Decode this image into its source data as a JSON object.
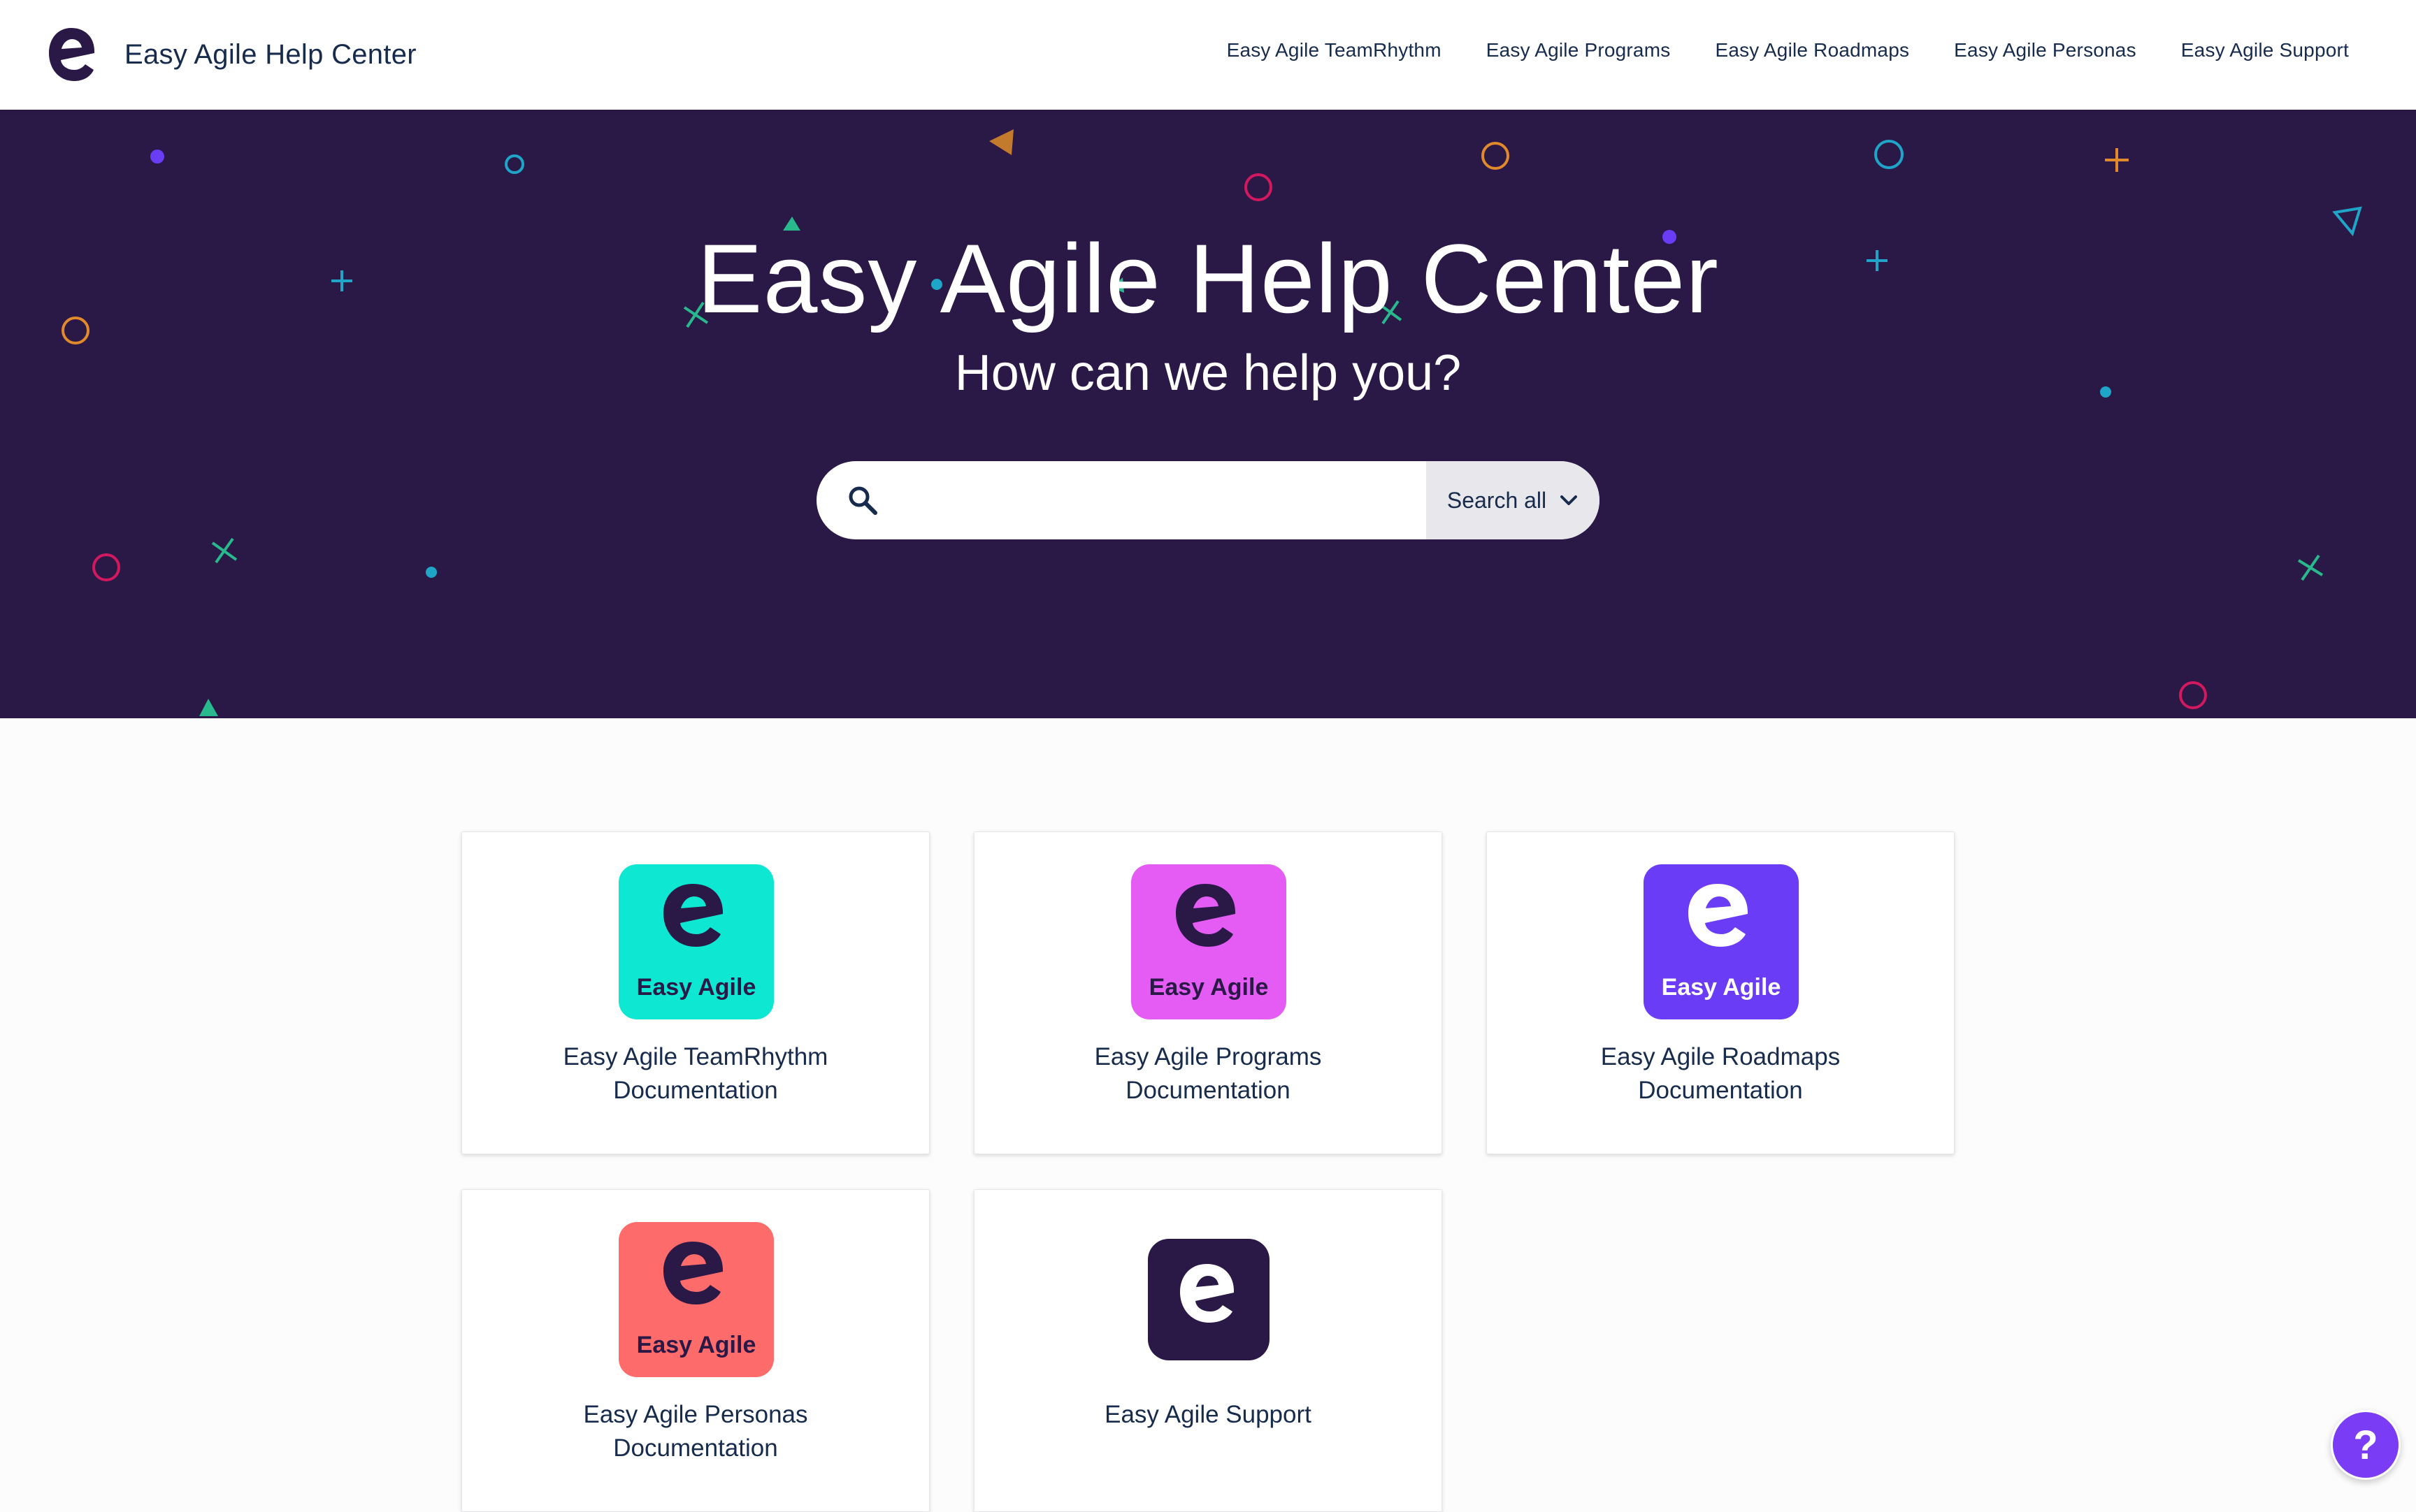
{
  "header": {
    "title": "Easy Agile Help Center",
    "logo_icon": "easy-agile-e-logo",
    "nav": [
      {
        "label": "Easy Agile TeamRhythm"
      },
      {
        "label": "Easy Agile Programs"
      },
      {
        "label": "Easy Agile Roadmaps"
      },
      {
        "label": "Easy Agile Personas"
      },
      {
        "label": "Easy Agile Support"
      }
    ]
  },
  "hero": {
    "title": "Easy Agile Help Center",
    "subtitle": "How can we help you?",
    "background_color": "#2a1846"
  },
  "search": {
    "value": "",
    "placeholder": "",
    "scope_label": "Search all",
    "icon": "search-icon"
  },
  "cards": [
    {
      "line1": "Easy Agile TeamRhythm",
      "line2": "Documentation",
      "icon_text": "Easy Agile",
      "icon_color": "#0ee8d2",
      "icon_name": "teamrhythm-app-icon"
    },
    {
      "line1": "Easy Agile Programs",
      "line2": "Documentation",
      "icon_text": "Easy Agile",
      "icon_color": "#e55cf5",
      "icon_name": "programs-app-icon"
    },
    {
      "line1": "Easy Agile Roadmaps",
      "line2": "Documentation",
      "icon_text": "Easy Agile",
      "icon_color": "#6b3cf5",
      "icon_name": "roadmaps-app-icon"
    },
    {
      "line1": "Easy Agile Personas",
      "line2": "Documentation",
      "icon_text": "Easy Agile",
      "icon_color": "#fe6b6b",
      "icon_name": "personas-app-icon"
    },
    {
      "line1": "Easy Agile Support",
      "line2": "",
      "icon_text": "",
      "icon_color": "#2a1846",
      "icon_name": "support-app-icon"
    }
  ],
  "help_button": {
    "label": "?",
    "color": "#7b3cf5"
  },
  "colors": {
    "brand_dark": "#2a1846",
    "text": "#172b4d"
  }
}
